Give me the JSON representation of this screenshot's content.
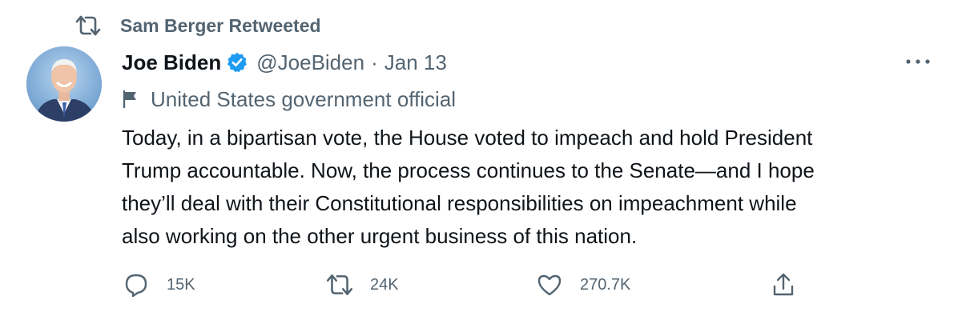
{
  "retweet_context": {
    "text": "Sam Berger Retweeted"
  },
  "author": {
    "name": "Joe Biden",
    "handle": "@JoeBiden",
    "separator": "·",
    "date": "Jan 13",
    "label": "United States government official"
  },
  "tweet": {
    "lines": [
      "Today, in a bipartisan vote, the House voted to impeach and hold President",
      "Trump accountable. Now, the process continues to the Senate—and I hope",
      "they’ll deal with their Constitutional responsibilities on impeachment while",
      "also working on the other urgent business of this nation."
    ]
  },
  "actions": {
    "replies": "15K",
    "retweets": "24K",
    "likes": "270.7K"
  },
  "icons": {
    "retweet": "retweet-icon",
    "verified": "verified-badge-icon",
    "more": "more-icon",
    "flag": "flag-icon",
    "reply": "reply-icon",
    "like": "heart-icon",
    "share": "share-icon"
  },
  "colors": {
    "text": "#0f1419",
    "secondary": "#536471",
    "verified": "#1d9bf0"
  }
}
